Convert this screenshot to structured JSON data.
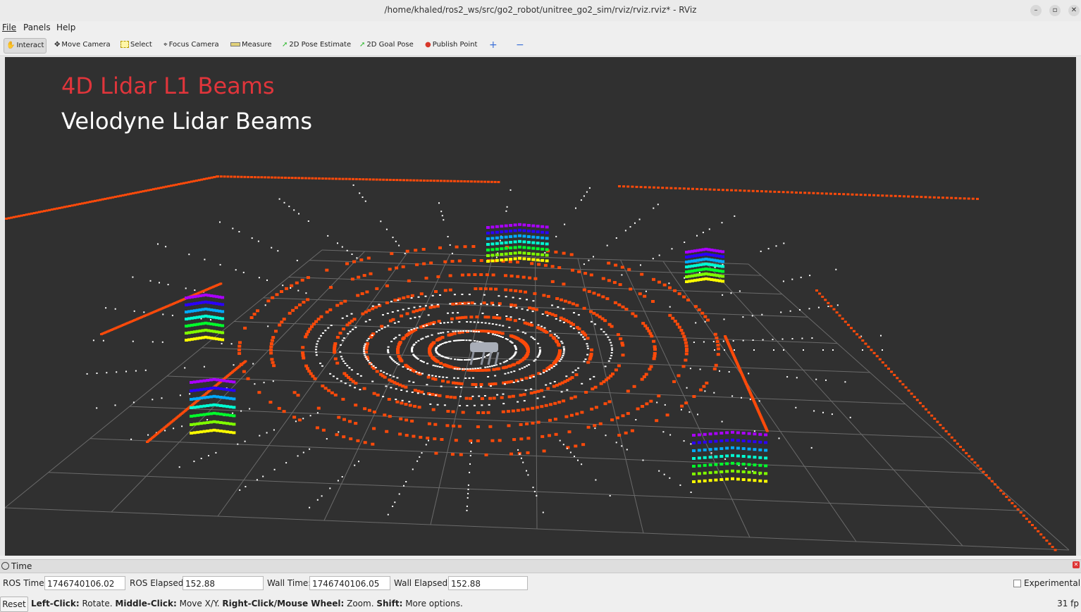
{
  "window": {
    "title": "/home/khaled/ros2_ws/src/go2_robot/unitree_go2_sim/rviz/rviz.rviz* - RViz"
  },
  "menu": [
    "File",
    "Panels",
    "Help"
  ],
  "toolbar": {
    "interact": "Interact",
    "move_camera": "Move Camera",
    "select": "Select",
    "focus_camera": "Focus Camera",
    "measure": "Measure",
    "pose_estimate": "2D Pose Estimate",
    "goal_pose": "2D Goal Pose",
    "publish_point": "Publish Point"
  },
  "overlay": {
    "line1": "4D Lidar L1 Beams",
    "line2": "Velodyne Lidar Beams"
  },
  "time_panel": {
    "title": "Time",
    "ros_time_label": "ROS Time:",
    "ros_time": "1746740106.02",
    "ros_elapsed_label": "ROS Elapsed:",
    "ros_elapsed": "152.88",
    "wall_time_label": "Wall Time:",
    "wall_time": "1746740106.05",
    "wall_elapsed_label": "Wall Elapsed:",
    "wall_elapsed": "152.88",
    "experimental": "Experimental"
  },
  "status": {
    "reset": "Reset",
    "hint_lc": "Left-Click:",
    "hint_lc_t": " Rotate. ",
    "hint_mc": "Middle-Click:",
    "hint_mc_t": " Move X/Y. ",
    "hint_rc": "Right-Click/Mouse Wheel:",
    "hint_rc_t": " Zoom. ",
    "hint_sh": "Shift:",
    "hint_sh_t": " More options.",
    "fps": "31 fp"
  },
  "colors": {
    "background": "#303030",
    "orange": "#ff4a0a",
    "white": "#ffffff",
    "grid": "#6a6a6a"
  }
}
